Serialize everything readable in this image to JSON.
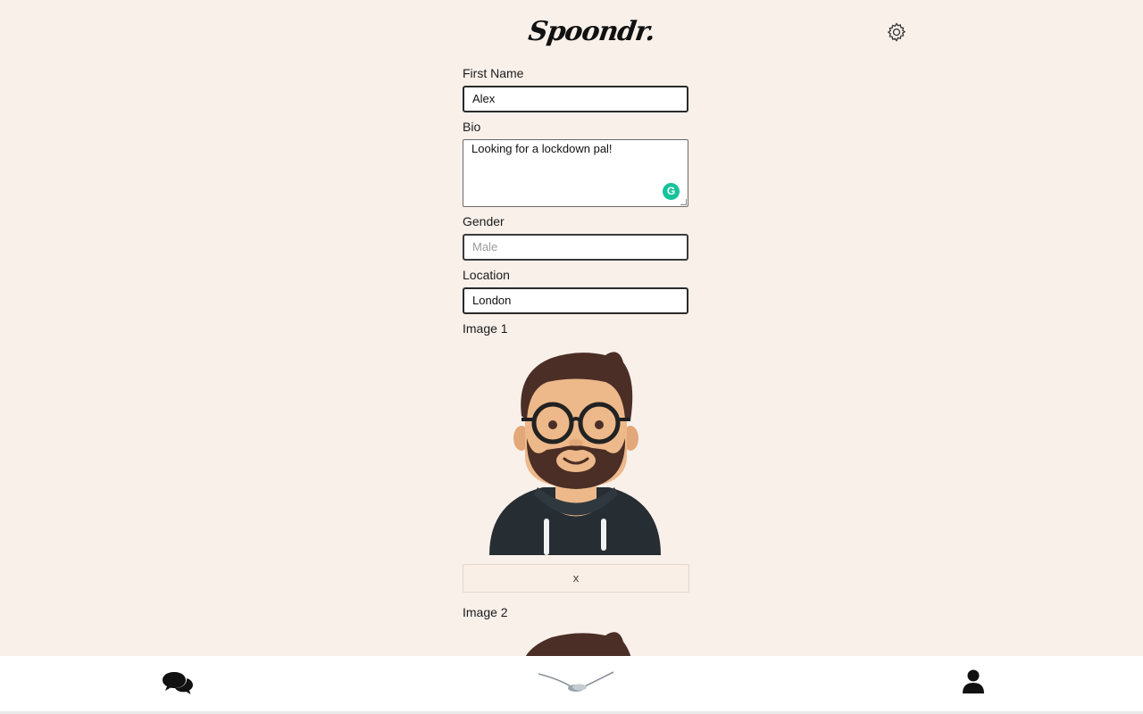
{
  "app": {
    "logo": "Spoondr.",
    "settings_icon": "gear-icon"
  },
  "profile_form": {
    "first_name": {
      "label": "First Name",
      "value": "Alex"
    },
    "bio": {
      "label": "Bio",
      "value": "Looking for a lockdown pal!",
      "grammarly_badge": "G"
    },
    "gender": {
      "label": "Gender",
      "placeholder": "Male"
    },
    "location": {
      "label": "Location",
      "value": "London"
    },
    "images": [
      {
        "label": "Image 1",
        "remove_label": "x"
      },
      {
        "label": "Image 2"
      }
    ]
  },
  "nav": {
    "items": [
      {
        "name": "messages",
        "icon": "chat-bubbles-icon"
      },
      {
        "name": "home",
        "icon": "spoons-icon"
      },
      {
        "name": "profile",
        "icon": "user-icon"
      }
    ]
  },
  "colors": {
    "background": "#f9f0ea",
    "grammarly": "#15c39a",
    "hair": "#4b2e26",
    "skin": "#edb98a",
    "hoodie": "#262e33"
  }
}
